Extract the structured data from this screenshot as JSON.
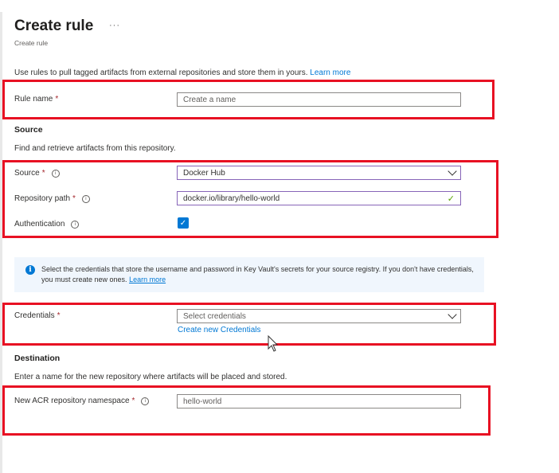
{
  "header": {
    "title": "Create rule",
    "more_icon": "ellipsis-icon",
    "subtitle": "Create rule"
  },
  "intro": {
    "text": "Use rules to pull tagged artifacts from external repositories and store them in yours. ",
    "learn_more": "Learn more"
  },
  "rule_name": {
    "label": "Rule name",
    "required": "*",
    "placeholder": "Create a name",
    "value": ""
  },
  "source_section": {
    "heading": "Source",
    "description": "Find and retrieve artifacts from this repository.",
    "source": {
      "label": "Source",
      "required": "*",
      "value": "Docker Hub"
    },
    "repository_path": {
      "label": "Repository path",
      "required": "*",
      "value": "docker.io/library/hello-world",
      "valid": true
    },
    "authentication": {
      "label": "Authentication",
      "checked": true
    }
  },
  "credentials_info": {
    "text": "Select the credentials that store the username and password in Key Vault's secrets for your source registry. If you don't have credentials, you must create new ones. ",
    "learn_more": "Learn more"
  },
  "credentials": {
    "label": "Credentials",
    "required": "*",
    "placeholder": "Select credentials",
    "create_link": "Create new Credentials"
  },
  "destination_section": {
    "heading": "Destination",
    "description": "Enter a name for the new repository where artifacts will be placed and stored.",
    "namespace": {
      "label": "New ACR repository namespace",
      "required": "*",
      "placeholder": "hello-world",
      "value": ""
    }
  },
  "colors": {
    "accent": "#0078d4",
    "highlight_box": "#e81123",
    "required": "#a4262c",
    "valid": "#57a300"
  }
}
